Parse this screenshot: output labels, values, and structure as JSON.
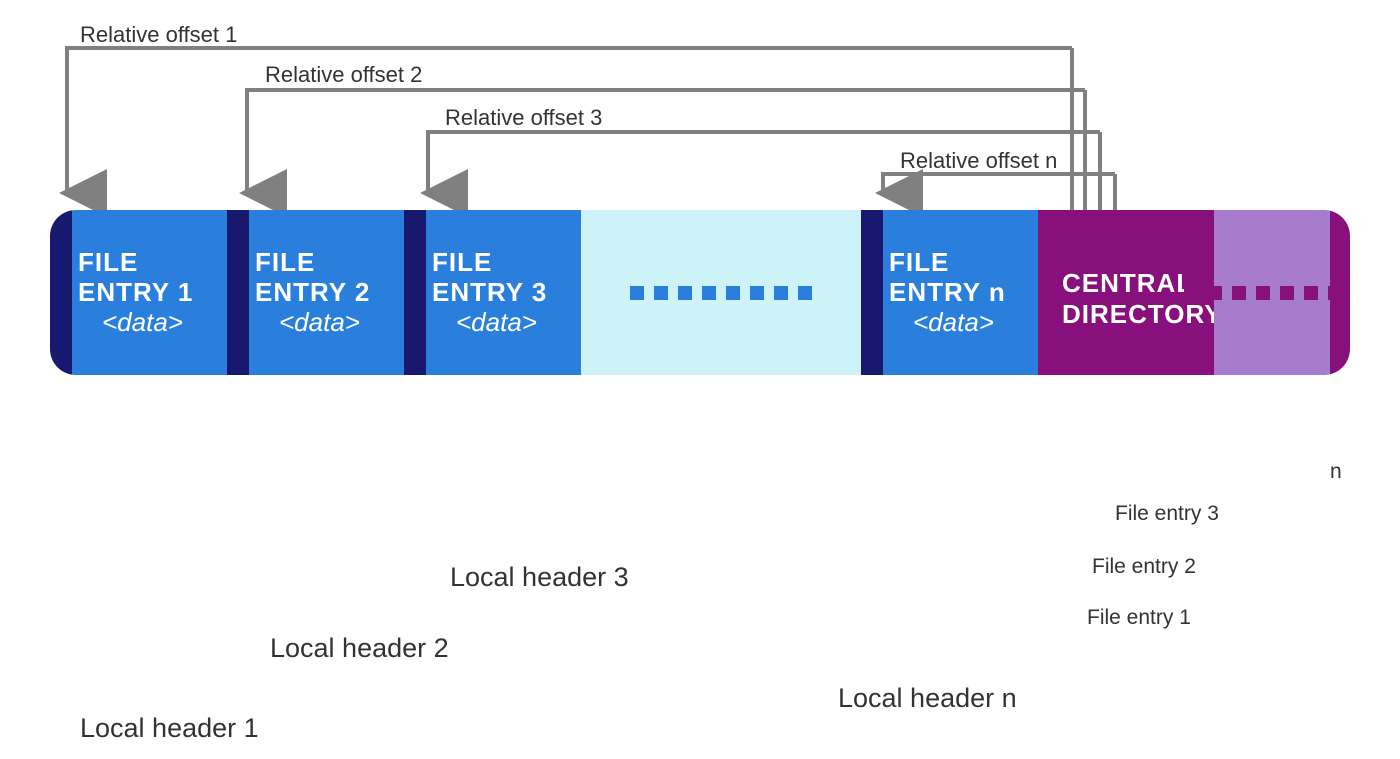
{
  "offsets": {
    "o1": "Relative offset 1",
    "o2": "Relative offset 2",
    "o3": "Relative offset 3",
    "on": "Relative offset n"
  },
  "entries": {
    "e1": {
      "l1": "FILE",
      "l2": "ENTRY 1",
      "data": "<data>"
    },
    "e2": {
      "l1": "FILE",
      "l2": "ENTRY 2",
      "data": "<data>"
    },
    "e3": {
      "l1": "FILE",
      "l2": "ENTRY 3",
      "data": "<data>"
    },
    "en": {
      "l1": "FILE",
      "l2": "ENTRY n",
      "data": "<data>"
    }
  },
  "central": {
    "l1": "CENTRAL",
    "l2": "DIRECTORY"
  },
  "local_headers": {
    "h1": "Local header 1",
    "h2": "Local header 2",
    "h3": "Local header 3",
    "hn": "Local header n"
  },
  "file_entry_labels": {
    "f1": "File entry 1",
    "f2": "File entry 2",
    "f3": "File entry 3",
    "fn": "n"
  },
  "colors": {
    "header_dark": "#18186f",
    "entry_blue": "#2a7fdc",
    "gap_cyan": "#cdf3f8",
    "cd_purple": "#87107c",
    "cd_light": "#a77ccf",
    "arrow_grey": "#808080"
  }
}
